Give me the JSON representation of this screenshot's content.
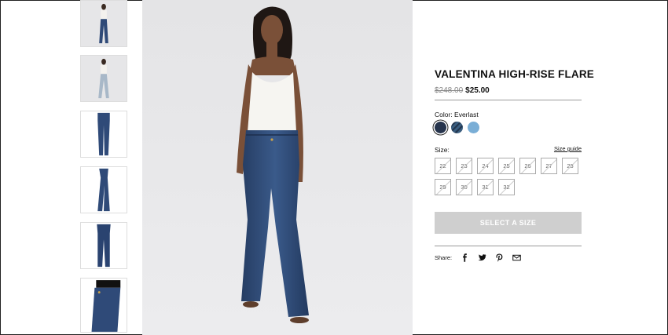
{
  "product": {
    "title": "VALENTINA HIGH-RISE FLARE",
    "price_old": "$248.00",
    "price_new": "$25.00",
    "color_label": "Color: Everlast",
    "size_label": "Size:",
    "size_guide": "Size guide",
    "cta": "SELECT A SIZE",
    "share_label": "Share:"
  },
  "swatches": [
    {
      "name": "Everlast",
      "color": "#26344d",
      "selected": true
    },
    {
      "name": "dark-stripe",
      "color": "#3a5e80",
      "selected": false
    },
    {
      "name": "light",
      "color": "#7aaed6",
      "selected": false
    }
  ],
  "sizes": [
    "22",
    "23",
    "24",
    "25",
    "26",
    "27",
    "28",
    "29",
    "30",
    "31",
    "32"
  ],
  "share_icons": [
    "facebook-icon",
    "twitter-icon",
    "pinterest-icon",
    "email-icon"
  ],
  "thumbnails": [
    "full-front-white-top",
    "full-front-light-jeans",
    "back-legs-dark",
    "side-legs-dark",
    "front-legs-dark",
    "waist-closeup"
  ],
  "colors": {
    "denim": "#2f4a78",
    "denim_light": "#a8b8c8",
    "cta_bg": "#cfcfcf",
    "backdrop": "#e6e6e8"
  }
}
